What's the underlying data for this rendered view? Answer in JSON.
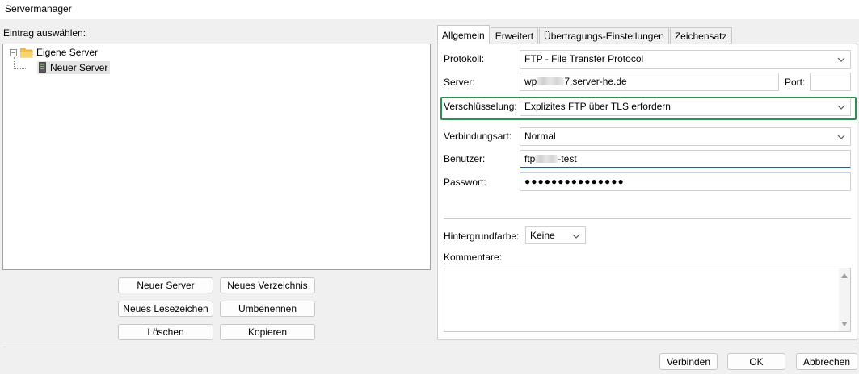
{
  "window": {
    "title": "Servermanager"
  },
  "left": {
    "select_label": "Eintrag auswählen:",
    "tree": {
      "root": "Eigene Server",
      "child": "Neuer Server",
      "expander": "−"
    },
    "buttons": {
      "new_server": "Neuer Server",
      "new_folder": "Neues Verzeichnis",
      "new_bookmark": "Neues Lesezeichen",
      "rename": "Umbenennen",
      "delete": "Löschen",
      "copy": "Kopieren"
    }
  },
  "tabs": [
    "Allgemein",
    "Erweitert",
    "Übertragungs-Einstellungen",
    "Zeichensatz"
  ],
  "general": {
    "protocol_label": "Protokoll:",
    "protocol_value": "FTP - File Transfer Protocol",
    "server_label": "Server:",
    "server_prefix": "wp",
    "server_suffix": "7.server-he.de",
    "port_label": "Port:",
    "port_value": "",
    "encryption_label": "Verschlüsselung:",
    "encryption_value": "Explizites FTP über TLS erfordern",
    "logon_label": "Verbindungsart:",
    "logon_value": "Normal",
    "user_label": "Benutzer:",
    "user_prefix": "ftp",
    "user_suffix": "-test",
    "password_label": "Passwort:",
    "password_value": "●●●●●●●●●●●●●●●",
    "bg_color_label": "Hintergrundfarbe:",
    "bg_color_value": "Keine",
    "comments_label": "Kommentare:"
  },
  "footer": {
    "connect": "Verbinden",
    "ok": "OK",
    "cancel": "Abbrechen"
  },
  "colors": {
    "highlight": "#2f8f4e",
    "focus_underline": "#1f5ea8",
    "folder": "#f3c14b"
  }
}
